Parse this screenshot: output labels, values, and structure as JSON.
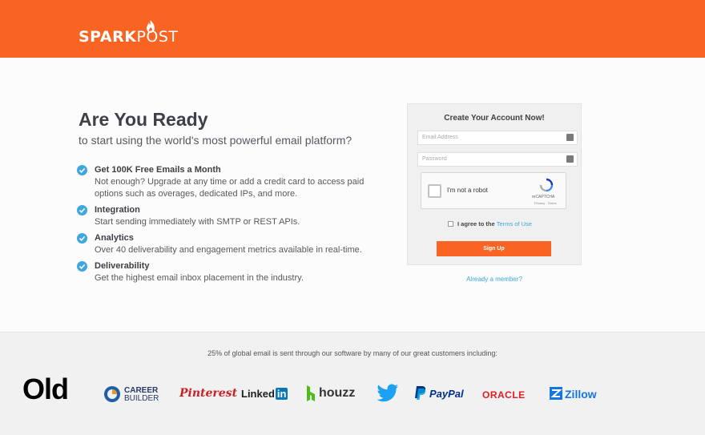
{
  "header": {
    "logo_text": "SPARKPOST"
  },
  "hero": {
    "title": "Are You Ready",
    "subtitle": "to start using the world's most powerful email platform?"
  },
  "features": [
    {
      "title": "Get 100K Free Emails a Month",
      "lines": [
        "Not enough? Upgrade at any time or add a credit card to access paid",
        "options such as overages, dedicated IPs, and more."
      ]
    },
    {
      "title": "Integration",
      "lines": [
        "Start sending immediately with SMTP or REST APIs."
      ]
    },
    {
      "title": "Analytics",
      "lines": [
        "Over 40 deliverability and engagement metrics available in real-time."
      ]
    },
    {
      "title": "Deliverability",
      "lines": [
        "Get the highest email inbox placement in the industry."
      ]
    }
  ],
  "form": {
    "title": "Create Your Account Now!",
    "email_placeholder": "Email Address",
    "password_placeholder": "Password",
    "captcha_label": "I'm not a robot",
    "captcha_brand": "reCAPTCHA",
    "captcha_links": "Privacy - Terms",
    "agree_prefix": "I agree to the",
    "agree_link": "Terms of Use",
    "signup_label": "Sign Up",
    "member_link": "Already a member?"
  },
  "footer": {
    "tagline": "25% of global email is sent through our software by many of our great customers including:",
    "overlay_label": "Old",
    "brands": [
      "CAREER BUILDER",
      "Pinterest",
      "LinkedIn",
      "houzz",
      "twitter",
      "PayPal",
      "ORACLE",
      "Zillow"
    ],
    "careerbuilder_line1": "CAREER",
    "careerbuilder_line2": "BUILDER",
    "pinterest": "Pinterest",
    "linkedin_a": "Linked",
    "linkedin_b": "in",
    "houzz": "houzz",
    "paypal": "PayPal",
    "oracle": "ORACLE",
    "zillow": "Zillow"
  },
  "colors": {
    "brand_orange": "#fa6423",
    "accent_blue": "#3ea7de"
  }
}
